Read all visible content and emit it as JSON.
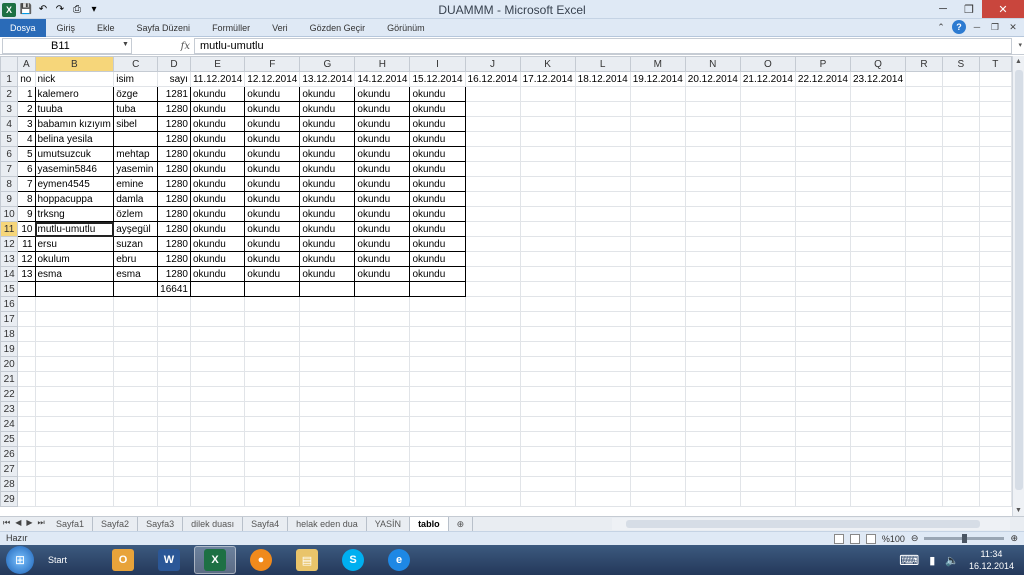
{
  "window": {
    "title": "DUAMMM  -  Microsoft Excel"
  },
  "ribbon": {
    "tabs": [
      "Dosya",
      "Giriş",
      "Ekle",
      "Sayfa Düzeni",
      "Formüller",
      "Veri",
      "Gözden Geçir",
      "Görünüm"
    ]
  },
  "formula_bar": {
    "cell_ref": "B11",
    "fx": "fx",
    "value": "mutlu-umutlu"
  },
  "columns": [
    "A",
    "B",
    "C",
    "D",
    "E",
    "F",
    "G",
    "H",
    "I",
    "J",
    "K",
    "L",
    "M",
    "N",
    "O",
    "P",
    "Q",
    "R",
    "S",
    "T"
  ],
  "rows": [
    [
      "no",
      "nick",
      "isim",
      "sayı",
      "11.12.2014",
      "12.12.2014",
      "13.12.2014",
      "14.12.2014",
      "15.12.2014",
      "16.12.2014",
      "17.12.2014",
      "18.12.2014",
      "19.12.2014",
      "20.12.2014",
      "21.12.2014",
      "22.12.2014",
      "23.12.2014",
      "",
      "",
      ""
    ],
    [
      "1",
      "kalemero",
      "özge",
      "1281",
      "okundu",
      "okundu",
      "okundu",
      "okundu",
      "okundu",
      "",
      "",
      "",
      "",
      "",
      "",
      "",
      "",
      "",
      "",
      ""
    ],
    [
      "2",
      "tuuba",
      "tuba",
      "1280",
      "okundu",
      "okundu",
      "okundu",
      "okundu",
      "okundu",
      "",
      "",
      "",
      "",
      "",
      "",
      "",
      "",
      "",
      "",
      ""
    ],
    [
      "3",
      "babamın kızıyım",
      "sibel",
      "1280",
      "okundu",
      "okundu",
      "okundu",
      "okundu",
      "okundu",
      "",
      "",
      "",
      "",
      "",
      "",
      "",
      "",
      "",
      "",
      ""
    ],
    [
      "4",
      "belina yesila",
      "",
      "1280",
      "okundu",
      "okundu",
      "okundu",
      "okundu",
      "okundu",
      "",
      "",
      "",
      "",
      "",
      "",
      "",
      "",
      "",
      "",
      ""
    ],
    [
      "5",
      "umutsuzcuk",
      "mehtap",
      "1280",
      "okundu",
      "okundu",
      "okundu",
      "okundu",
      "okundu",
      "",
      "",
      "",
      "",
      "",
      "",
      "",
      "",
      "",
      "",
      ""
    ],
    [
      "6",
      "yasemin5846",
      "yasemin",
      "1280",
      "okundu",
      "okundu",
      "okundu",
      "okundu",
      "okundu",
      "",
      "",
      "",
      "",
      "",
      "",
      "",
      "",
      "",
      "",
      ""
    ],
    [
      "7",
      "eymen4545",
      "emine",
      "1280",
      "okundu",
      "okundu",
      "okundu",
      "okundu",
      "okundu",
      "",
      "",
      "",
      "",
      "",
      "",
      "",
      "",
      "",
      "",
      ""
    ],
    [
      "8",
      "hoppacuppa",
      "damla",
      "1280",
      "okundu",
      "okundu",
      "okundu",
      "okundu",
      "okundu",
      "",
      "",
      "",
      "",
      "",
      "",
      "",
      "",
      "",
      "",
      ""
    ],
    [
      "9",
      "trksng",
      "özlem",
      "1280",
      "okundu",
      "okundu",
      "okundu",
      "okundu",
      "okundu",
      "",
      "",
      "",
      "",
      "",
      "",
      "",
      "",
      "",
      "",
      ""
    ],
    [
      "10",
      "mutlu-umutlu",
      "ayşegül",
      "1280",
      "okundu",
      "okundu",
      "okundu",
      "okundu",
      "okundu",
      "",
      "",
      "",
      "",
      "",
      "",
      "",
      "",
      "",
      "",
      ""
    ],
    [
      "11",
      "ersu",
      "suzan",
      "1280",
      "okundu",
      "okundu",
      "okundu",
      "okundu",
      "okundu",
      "",
      "",
      "",
      "",
      "",
      "",
      "",
      "",
      "",
      "",
      ""
    ],
    [
      "12",
      "okulum",
      "ebru",
      "1280",
      "okundu",
      "okundu",
      "okundu",
      "okundu",
      "okundu",
      "",
      "",
      "",
      "",
      "",
      "",
      "",
      "",
      "",
      "",
      ""
    ],
    [
      "13",
      "esma",
      "esma",
      "1280",
      "okundu",
      "okundu",
      "okundu",
      "okundu",
      "okundu",
      "",
      "",
      "",
      "",
      "",
      "",
      "",
      "",
      "",
      "",
      ""
    ],
    [
      "",
      "",
      "",
      "16641",
      "",
      "",
      "",
      "",
      "",
      "",
      "",
      "",
      "",
      "",
      "",
      "",
      "",
      "",
      "",
      ""
    ]
  ],
  "total_rows": 29,
  "sheet_tabs": [
    "Sayfa1",
    "Sayfa2",
    "Sayfa3",
    "dilek duası",
    "Sayfa4",
    "helak eden dua",
    "YASİN",
    "tablo"
  ],
  "active_sheet": "tablo",
  "status": {
    "text": "Hazır",
    "zoom": "%100"
  },
  "taskbar": {
    "start_label": "Start",
    "time": "11:34",
    "date": "16.12.2014"
  }
}
